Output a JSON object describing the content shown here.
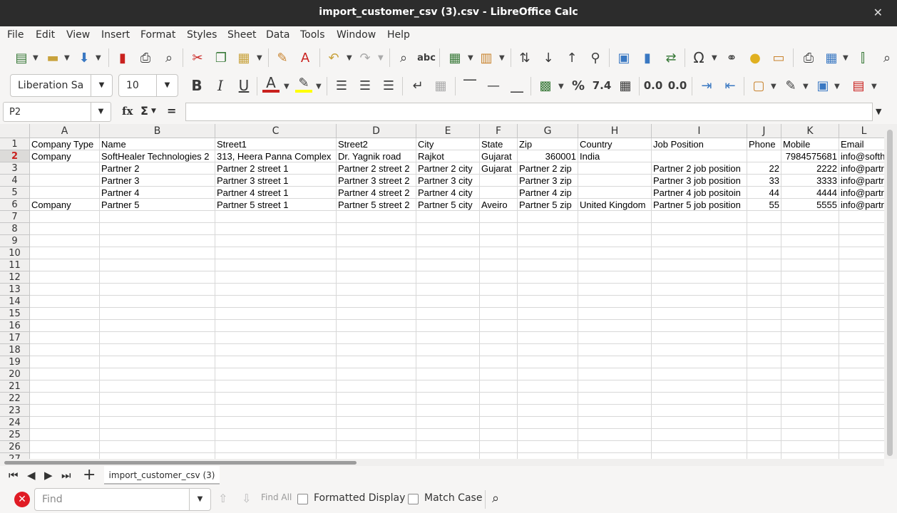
{
  "window": {
    "title": "import_customer_csv (3).csv - LibreOffice Calc",
    "close_glyph": "✕"
  },
  "menu": [
    "File",
    "Edit",
    "View",
    "Insert",
    "Format",
    "Styles",
    "Sheet",
    "Data",
    "Tools",
    "Window",
    "Help"
  ],
  "formatting": {
    "font_name": "Liberation Sa",
    "font_size": "10",
    "number_format_glyph": "%",
    "decimal_glyph": "7.4",
    "add_decimal_glyph": "0.0",
    "del_decimal_glyph": "0.0"
  },
  "formula_bar": {
    "cell_ref": "P2",
    "fx": "fx",
    "sum": "Σ",
    "equals": "=",
    "content": ""
  },
  "columns": [
    {
      "letter": "A"
    },
    {
      "letter": "B"
    },
    {
      "letter": "C"
    },
    {
      "letter": "D"
    },
    {
      "letter": "E"
    },
    {
      "letter": "F"
    },
    {
      "letter": "G"
    },
    {
      "letter": "H"
    },
    {
      "letter": "I"
    },
    {
      "letter": "J"
    },
    {
      "letter": "K"
    },
    {
      "letter": "L"
    }
  ],
  "rows": [
    [
      "Company Type",
      "Name",
      "Street1",
      "Street2",
      "City",
      "State",
      "Zip",
      "Country",
      "Job Position",
      "Phone",
      "Mobile",
      "Email"
    ],
    [
      "Company",
      "SoftHealer Technologies 2",
      "313, Heera Panna Complex",
      "Dr. Yagnik road",
      "Rajkot",
      "Gujarat",
      "360001",
      "India",
      "",
      "",
      "7984575681",
      "info@softh"
    ],
    [
      "",
      "Partner 2",
      "Partner 2 street 1",
      "Partner 2 street 2",
      "Partner 2 city",
      "Gujarat",
      "Partner 2 zip",
      "",
      "Partner 2 job position",
      "22",
      "2222",
      "info@partr"
    ],
    [
      "",
      "Partner 3",
      "Partner 3 street 1",
      "Partner 3 street 2",
      "Partner 3 city",
      "",
      "Partner 3 zip",
      "",
      "Partner 3 job position",
      "33",
      "3333",
      "info@partr"
    ],
    [
      "",
      "Partner 4",
      "Partner 4 street 1",
      "Partner 4 street 2",
      "Partner 4 city",
      "",
      "Partner 4 zip",
      "",
      "Partner 4 job positoin",
      "44",
      "4444",
      "info@partr"
    ],
    [
      "Company",
      "Partner 5",
      "Partner 5 street 1",
      "Partner 5 street 2",
      "Partner 5 city",
      "Aveiro",
      "Partner 5 zip",
      "United Kingdom",
      "Partner 5 job position",
      "55",
      "5555",
      "info@partr"
    ]
  ],
  "row_numbers": [
    "1",
    "2",
    "3",
    "4",
    "5",
    "6",
    "7",
    "8",
    "9",
    "10",
    "11",
    "12",
    "13",
    "14",
    "15",
    "16",
    "17",
    "18",
    "19",
    "20",
    "21",
    "22",
    "23",
    "24",
    "25",
    "26",
    "27"
  ],
  "active_row": "2",
  "sheet_tab": {
    "label": "import_customer_csv (3)",
    "add_glyph": "+"
  },
  "find_bar": {
    "placeholder": "Find",
    "find_all": "Find All",
    "formatted_display": "Formatted Display",
    "match_case": "Match Case"
  },
  "colors": {
    "active_row_text": "#c9211e",
    "titlebar": "#2c2c2c",
    "close_button": "#e01b24"
  }
}
